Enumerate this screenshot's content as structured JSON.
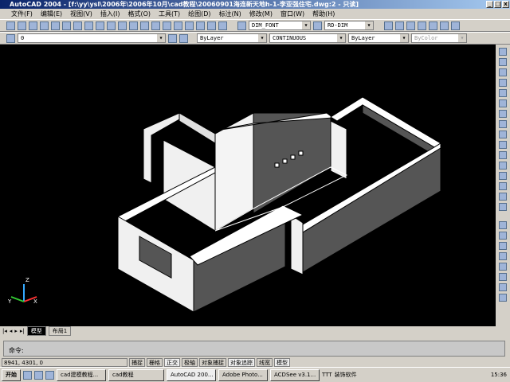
{
  "title": "AutoCAD 2004 - [f:\\yy\\ysl\\2006年\\2006年10月\\cad教程\\20060901海连新天地h-1-李亚强住宅.dwg:2 - 只读]",
  "menu": [
    "文件(F)",
    "编辑(E)",
    "视图(V)",
    "插入(I)",
    "格式(O)",
    "工具(T)",
    "绘图(D)",
    "标注(N)",
    "修改(M)",
    "窗口(W)",
    "帮助(H)"
  ],
  "toolbar": {
    "text_style": "DIM_FONT",
    "dim_style": "RD-DIM",
    "layer": "0",
    "color": "ByLayer",
    "linetype": "CONTINUOUS",
    "lineweight": "ByLayer",
    "plotstyle": "ByColor"
  },
  "tabs": [
    "模型",
    "布局1"
  ],
  "command": {
    "prompt": "命令:"
  },
  "status": {
    "coords": "8941,  4301, 0",
    "buttons": [
      "捕捉",
      "栅格",
      "正交",
      "极轴",
      "对象捕捉",
      "对象追踪",
      "线宽",
      "模型"
    ]
  },
  "taskbar": {
    "start": "开始",
    "items": [
      "cad建模教程...",
      "cad教程",
      "AutoCAD 200...",
      "Adobe Photo...",
      "ACDSee v3.1..."
    ],
    "tray_text": [
      "TTT",
      "装饰软件"
    ],
    "clock": "15:36"
  },
  "ucs": {
    "x": "X",
    "y": "Y",
    "z": "Z"
  },
  "colors": {
    "wall_light": "#f0f0f0",
    "wall_dark": "#555555",
    "background": "#000000"
  }
}
